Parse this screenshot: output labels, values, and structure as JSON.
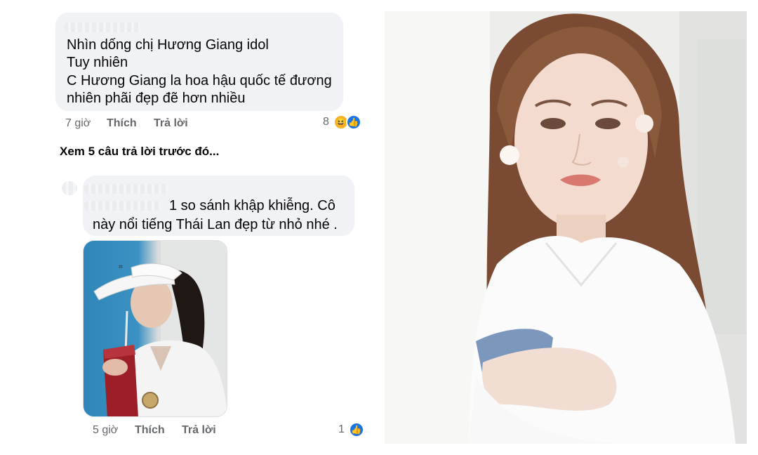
{
  "comment1": {
    "lines": [
      "Nhìn dống chị Hương Giang idol",
      "Tuy nhiên",
      "C Hương Giang la hoa hậu quốc tế đương",
      "nhiên phãi đẹp đẽ hơn nhiều"
    ],
    "time": "7 giờ",
    "like_label": "Thích",
    "reply_label": "Trả lời",
    "reaction_count": "8",
    "reaction_icons": [
      "haha-icon",
      "like-icon"
    ]
  },
  "view_more": "Xem 5 câu trả lời trước đó...",
  "comment2": {
    "lines": [
      "1 so sánh khập khiễng. Cô",
      "này nổi tiếng Thái Lan đẹp từ nhỏ nhé ."
    ],
    "time": "5 giờ",
    "like_label": "Thích",
    "reply_label": "Trả lời",
    "reaction_count": "1",
    "reaction_icons": [
      "like-icon"
    ]
  },
  "colors": {
    "bubble": "#f0f2f5",
    "meta_text": "#65676b",
    "like_blue": "#1b74e4"
  }
}
